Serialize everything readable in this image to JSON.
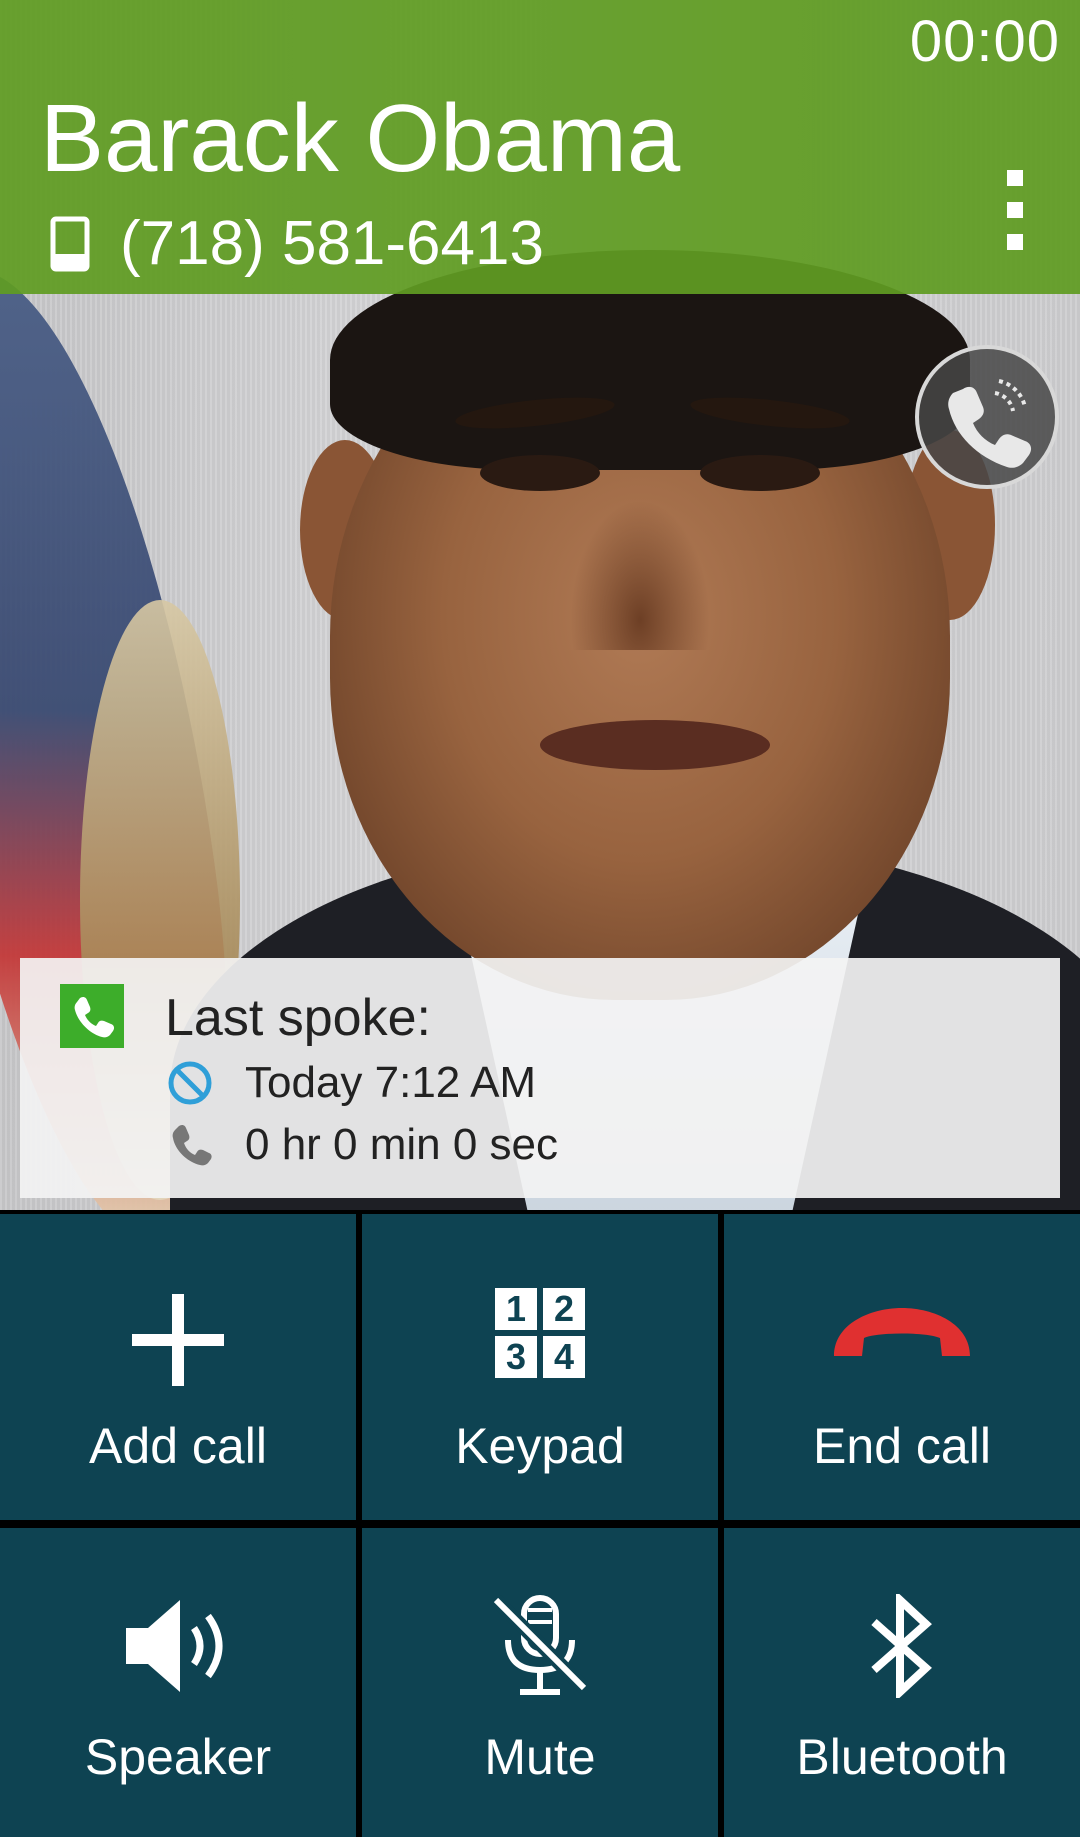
{
  "call": {
    "timer": "00:00",
    "contact_name": "Barack Obama",
    "phone_number": "(718) 581-6413"
  },
  "last_spoke": {
    "title": "Last spoke:",
    "date": "Today 7:12 AM",
    "duration": "0 hr 0 min 0 sec"
  },
  "actions": {
    "add_call": "Add call",
    "keypad": "Keypad",
    "end_call": "End call",
    "speaker": "Speaker",
    "mute": "Mute",
    "bluetooth": "Bluetooth"
  },
  "keypad_digits": [
    "1",
    "2",
    "3",
    "4"
  ],
  "icons": {
    "mobile": "mobile-phone-icon",
    "overflow": "overflow-menu-icon",
    "voice": "call-volume-icon",
    "call_log": "call-log-icon",
    "rejected": "blocked-icon",
    "duration": "handset-icon",
    "add": "plus-icon",
    "keypad": "keypad-icon",
    "end": "end-call-icon",
    "speaker": "speaker-icon",
    "mute": "mute-mic-icon",
    "bluetooth": "bluetooth-icon"
  },
  "colors": {
    "header_green": "#609c22",
    "button_teal": "#0e4352",
    "end_call_red": "#e03030",
    "call_log_green": "#3dad2a",
    "blocked_blue": "#2f9fd8"
  }
}
